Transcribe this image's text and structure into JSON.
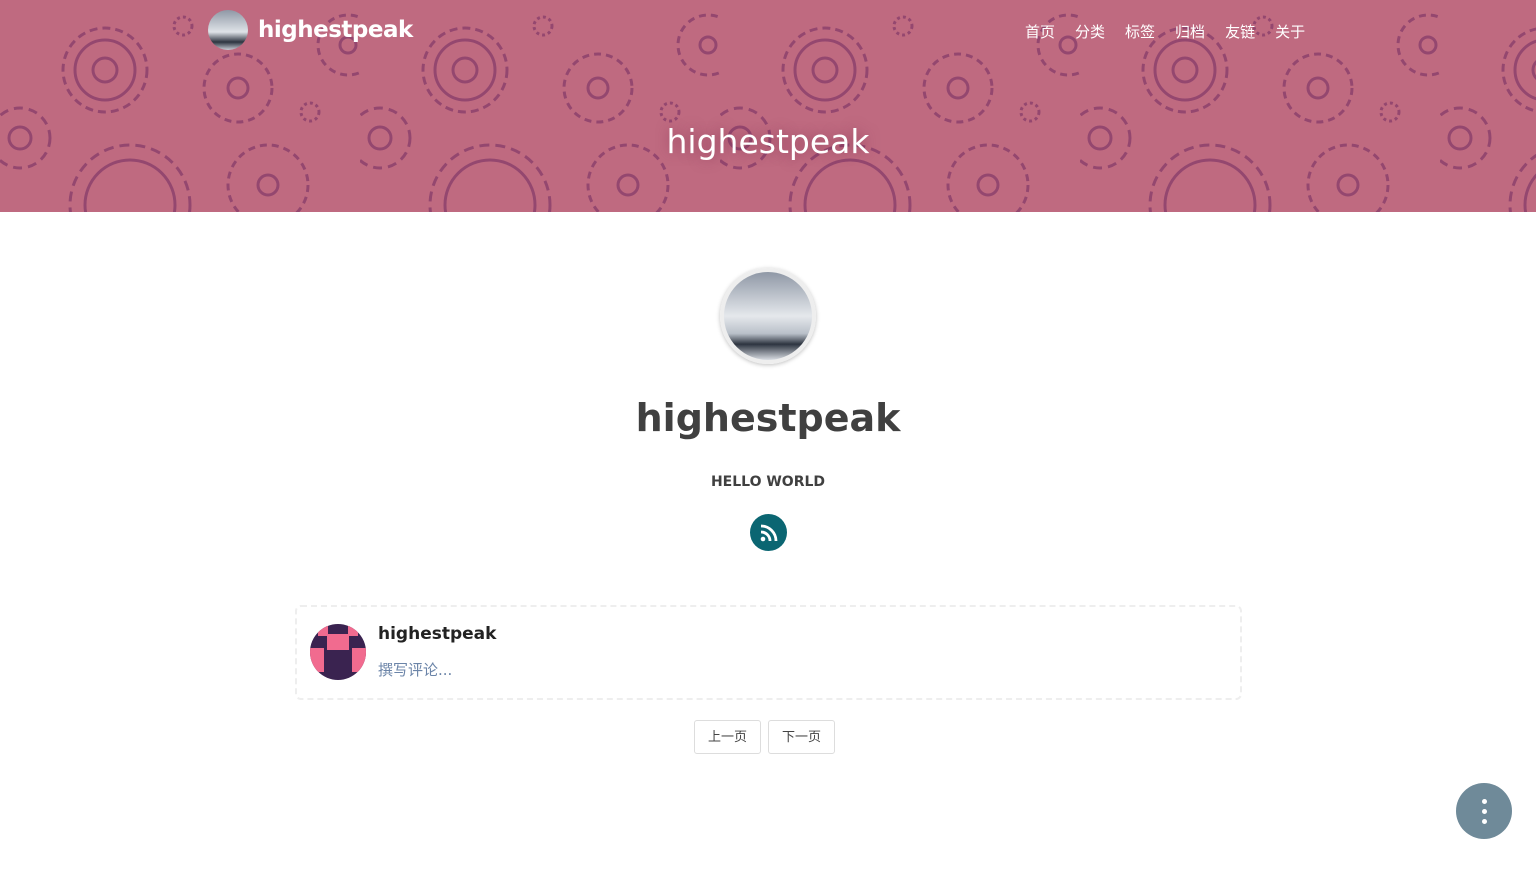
{
  "header": {
    "brand": "highestpeak",
    "nav": [
      "首页",
      "分类",
      "标签",
      "归档",
      "友链",
      "关于"
    ],
    "hero_title": "highestpeak",
    "bg_color": "#bf6a80"
  },
  "profile": {
    "name": "highestpeak",
    "motto": "HELLO WORLD",
    "rss_icon": "rss-icon",
    "rss_color": "#0b6672"
  },
  "comment": {
    "user": "highestpeak",
    "placeholder": "撰写评论..."
  },
  "pager": {
    "prev": "上一页",
    "next": "下一页"
  },
  "fab": {
    "icon": "more-vertical-icon"
  }
}
